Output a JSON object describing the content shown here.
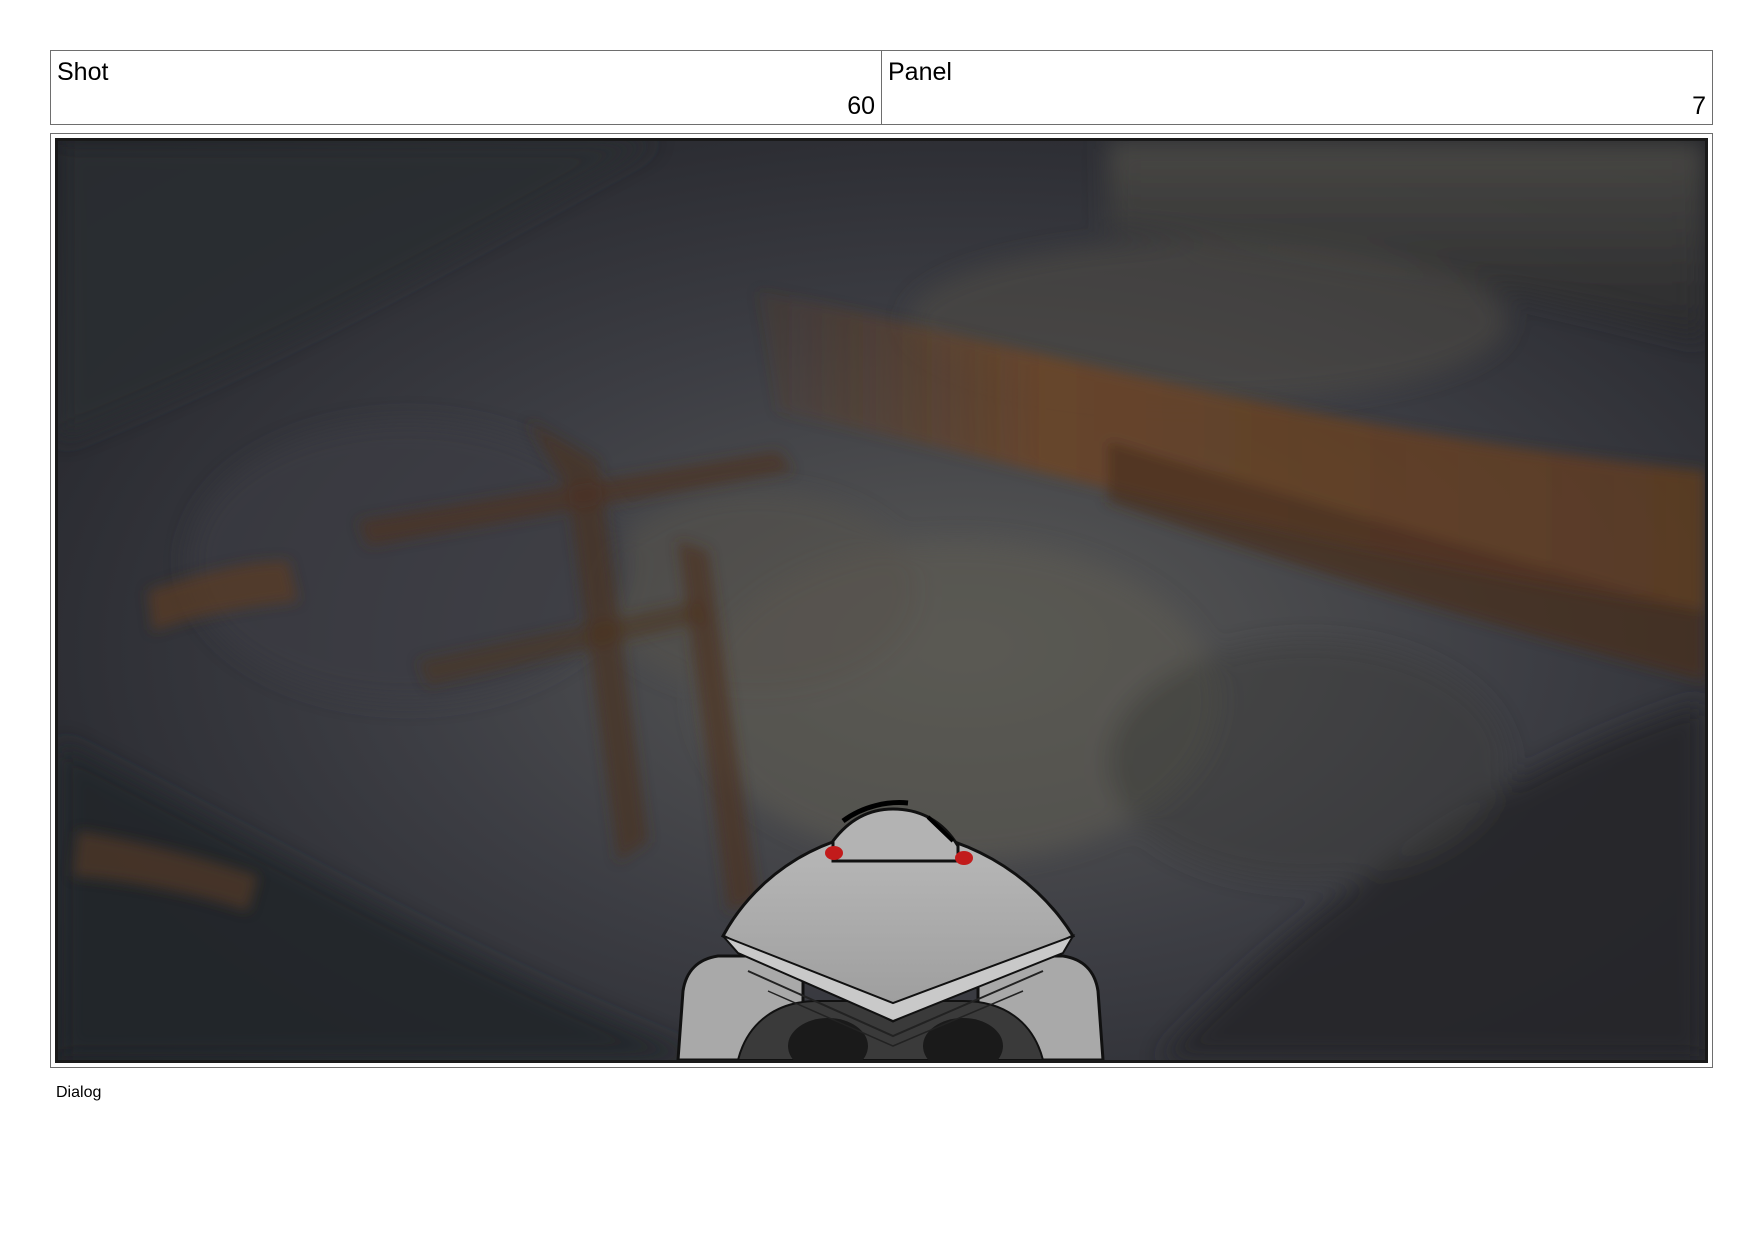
{
  "header": {
    "shot_label": "Shot",
    "shot_value": "60",
    "panel_label": "Panel",
    "panel_value": "7"
  },
  "frame": {
    "description_icon": "storyboard-frame-image"
  },
  "footer": {
    "dialog_label": "Dialog"
  }
}
